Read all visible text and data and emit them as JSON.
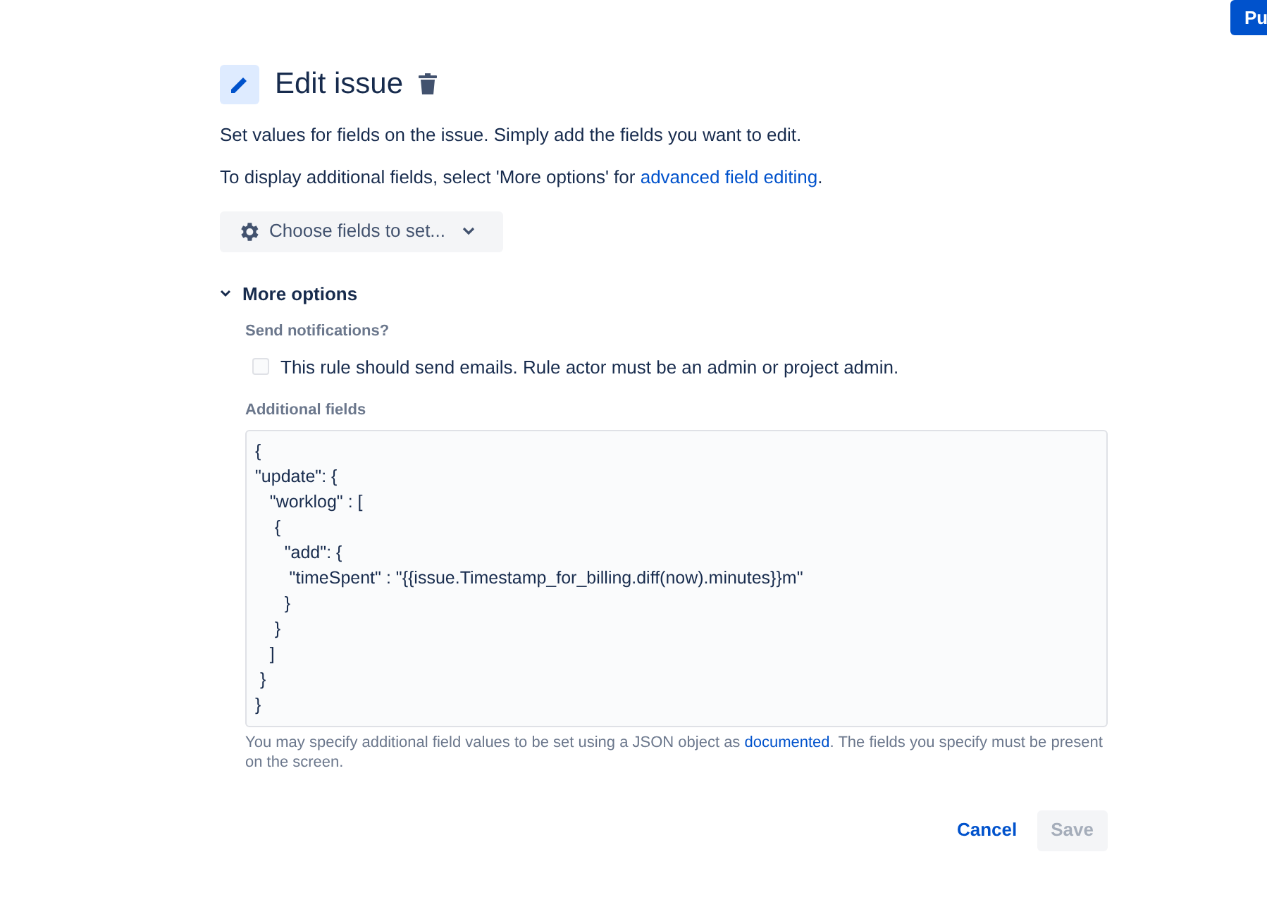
{
  "corner_button": "Pu",
  "title": "Edit issue",
  "description": "Set values for fields on the issue. Simply add the fields you want to edit.",
  "advanced_note": {
    "text": "To display additional fields, select 'More options' for ",
    "link": "advanced field editing",
    "end": "."
  },
  "choose_fields": {
    "label": "Choose fields to set..."
  },
  "more_options": {
    "label": "More options",
    "expanded": true
  },
  "notifications": {
    "label": "Send notifications?",
    "checkbox": {
      "label": "This rule should send emails. Rule actor must be an admin or project admin.",
      "checked": false
    }
  },
  "additional_fields": {
    "label": "Additional fields",
    "value": "{\n\"update\": {\n   \"worklog\" : [\n    {\n      \"add\": {\n       \"timeSpent\" : \"{{issue.Timestamp_for_billing.diff(now).minutes}}m\"\n      }\n    }\n   ]\n }\n}",
    "help": {
      "text": "You may specify additional field values to be set using a JSON object as ",
      "link": "documented",
      "end": ". The fields you specify must be present on the screen."
    }
  },
  "buttons": [
    {
      "label": "Cancel",
      "kind": "link",
      "disabled": false
    },
    {
      "label": "Save",
      "kind": "primary",
      "disabled": true
    }
  ]
}
